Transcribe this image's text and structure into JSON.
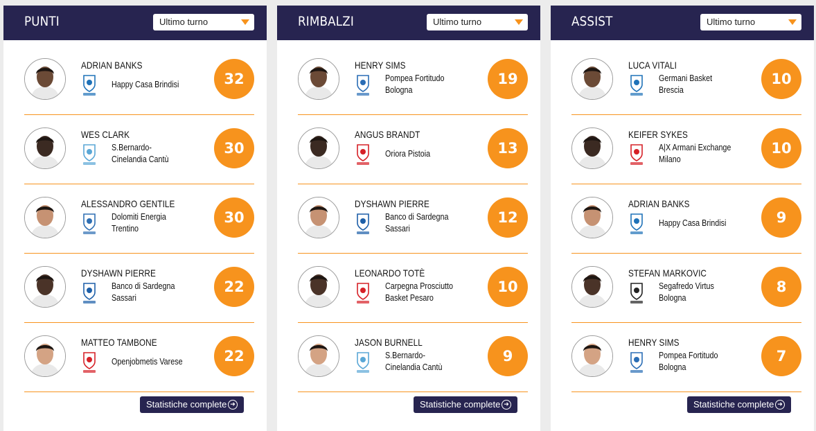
{
  "colors": {
    "header": "#272450",
    "accent": "#f7931d",
    "panel": "#ffffff",
    "background": "#ececec"
  },
  "nav": {
    "prev_icon": "chevron-left-icon",
    "next_icon": "chevron-right-icon"
  },
  "panels": [
    {
      "title": "PUNTI",
      "select": {
        "selected": "Ultimo turno"
      },
      "button_label": "Statistiche complete",
      "rows": [
        {
          "name": "ADRIAN BANKS",
          "team_lines": [
            "Happy Casa Brindisi"
          ],
          "value": "32",
          "logo_icon": "brindisi-logo-icon",
          "logo_color": "#1f72b8"
        },
        {
          "name": "WES CLARK",
          "team_lines": [
            "S.Bernardo-",
            "Cinelandia Cantù"
          ],
          "value": "30",
          "logo_icon": "cantu-logo-icon",
          "logo_color": "#5aa7d6"
        },
        {
          "name": "ALESSANDRO GENTILE",
          "team_lines": [
            "Dolomiti Energia",
            "Trentino"
          ],
          "value": "30",
          "logo_icon": "trentino-logo-icon",
          "logo_color": "#2f6fb3"
        },
        {
          "name": "DYSHAWN PIERRE",
          "team_lines": [
            "Banco di Sardegna",
            "Sassari"
          ],
          "value": "22",
          "logo_icon": "sassari-logo-icon",
          "logo_color": "#1d5fa8"
        },
        {
          "name": "MATTEO TAMBONE",
          "team_lines": [
            "Openjobmetis Varese"
          ],
          "value": "22",
          "logo_icon": "varese-logo-icon",
          "logo_color": "#d62027"
        }
      ]
    },
    {
      "title": "RIMBALZI",
      "select": {
        "selected": "Ultimo turno"
      },
      "button_label": "Statistiche complete",
      "rows": [
        {
          "name": "HENRY SIMS",
          "team_lines": [
            "Pompea Fortitudo",
            "Bologna"
          ],
          "value": "19",
          "logo_icon": "fortitudo-logo-icon",
          "logo_color": "#2a6db5"
        },
        {
          "name": "ANGUS BRANDT",
          "team_lines": [
            "Oriora Pistoia"
          ],
          "value": "13",
          "logo_icon": "pistoia-logo-icon",
          "logo_color": "#d62027"
        },
        {
          "name": "DYSHAWN PIERRE",
          "team_lines": [
            "Banco di Sardegna",
            "Sassari"
          ],
          "value": "12",
          "logo_icon": "sassari-logo-icon",
          "logo_color": "#1d5fa8"
        },
        {
          "name": "LEONARDO TOTÈ",
          "team_lines": [
            "Carpegna Prosciutto",
            "Basket Pesaro"
          ],
          "value": "10",
          "logo_icon": "pesaro-logo-icon",
          "logo_color": "#d62027"
        },
        {
          "name": "JASON BURNELL",
          "team_lines": [
            "S.Bernardo-",
            "Cinelandia Cantù"
          ],
          "value": "9",
          "logo_icon": "cantu-logo-icon",
          "logo_color": "#5aa7d6"
        }
      ]
    },
    {
      "title": "ASSIST",
      "select": {
        "selected": "Ultimo turno"
      },
      "button_label": "Statistiche complete",
      "rows": [
        {
          "name": "LUCA VITALI",
          "team_lines": [
            "Germani Basket",
            "Brescia"
          ],
          "value": "10",
          "logo_icon": "brescia-logo-icon",
          "logo_color": "#1f72b8"
        },
        {
          "name": "KEIFER SYKES",
          "team_lines": [
            "A|X Armani Exchange",
            "Milano"
          ],
          "value": "10",
          "logo_icon": "milano-logo-icon",
          "logo_color": "#d62027"
        },
        {
          "name": "ADRIAN BANKS",
          "team_lines": [
            "Happy Casa Brindisi"
          ],
          "value": "9",
          "logo_icon": "brindisi-logo-icon",
          "logo_color": "#1f72b8"
        },
        {
          "name": "STEFAN MARKOVIC",
          "team_lines": [
            "Segafredo Virtus",
            "Bologna"
          ],
          "value": "8",
          "logo_icon": "virtus-logo-icon",
          "logo_color": "#222222"
        },
        {
          "name": "HENRY SIMS",
          "team_lines": [
            "Pompea Fortitudo",
            "Bologna"
          ],
          "value": "7",
          "logo_icon": "fortitudo-logo-icon",
          "logo_color": "#2a6db5"
        }
      ]
    }
  ]
}
